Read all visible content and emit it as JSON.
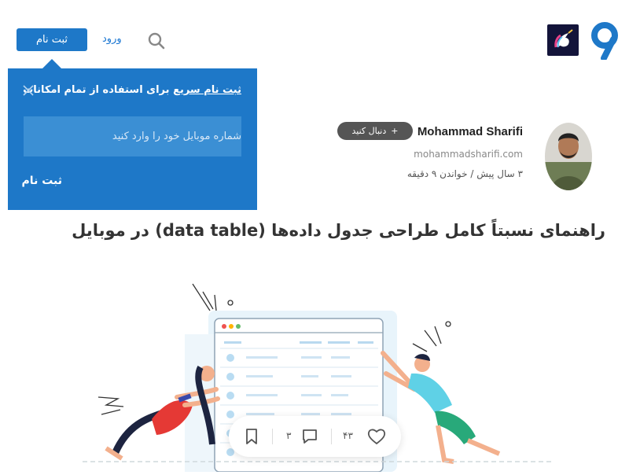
{
  "header": {
    "login_label": "ورود",
    "signup_label": "ثبت نام",
    "icons": [
      "virgool-logo-icon",
      "unicorn-logo-icon",
      "search-icon"
    ],
    "brand_color": "#1e78c8"
  },
  "popup": {
    "title_highlight": "ثبت نام سریع",
    "title_rest": " برای استفاده از تمام امکانات",
    "input_placeholder": "شماره موبایل خود را وارد کنید",
    "submit_label": "ثبت نام",
    "background_color": "#1e78c8"
  },
  "author": {
    "name": "Mohammad Sharifi",
    "follow_label": "دنبال کنید",
    "follow_plus": "+",
    "site": "mohammadsharifi.com",
    "meta": "۳ سال پیش / خواندن ۹ دقیقه"
  },
  "post": {
    "title": "راهنمای نسبتاً کامل طراحی جدول داده‌ها (data table) در موبایل"
  },
  "actions": {
    "likes": "۴۳",
    "comments": "۳"
  }
}
